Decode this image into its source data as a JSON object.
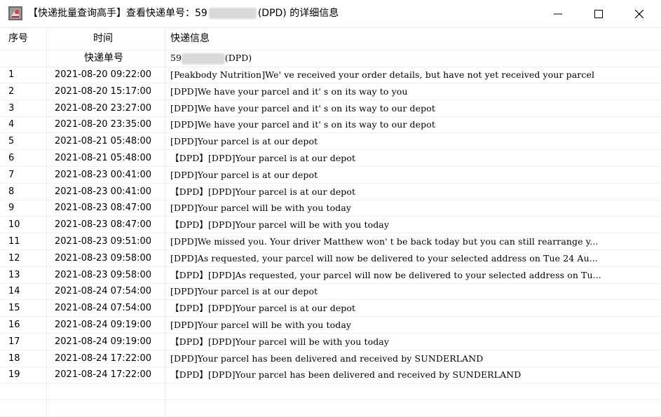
{
  "window": {
    "title_prefix": "【快递批量查询高手】查看快递单号：59",
    "title_suffix": "(DPD) 的详细信息"
  },
  "columns": {
    "no": "序号",
    "time": "时间",
    "info": "快递信息",
    "tracking_label": "快递单号",
    "tracking_prefix": "59",
    "tracking_suffix": "(DPD)"
  },
  "rows": [
    {
      "no": "1",
      "time": "2021-08-20 09:22:00",
      "info": "[Peakbody Nutrition]We' ve received your order details, but have not yet received your parcel"
    },
    {
      "no": "2",
      "time": "2021-08-20 15:17:00",
      "info": "[DPD]We have your parcel and it' s on its way to you"
    },
    {
      "no": "3",
      "time": "2021-08-20 23:27:00",
      "info": "[DPD]We have your parcel and it' s on its way to our depot"
    },
    {
      "no": "4",
      "time": "2021-08-20 23:35:00",
      "info": "[DPD]We have your parcel and it' s on its way to our depot"
    },
    {
      "no": "5",
      "time": "2021-08-21 05:48:00",
      "info": "[DPD]Your parcel is at our depot"
    },
    {
      "no": "6",
      "time": "2021-08-21 05:48:00",
      "info": "【DPD】[DPD]Your parcel is at our depot"
    },
    {
      "no": "7",
      "time": "2021-08-23 00:41:00",
      "info": "[DPD]Your parcel is at our depot"
    },
    {
      "no": "8",
      "time": "2021-08-23 00:41:00",
      "info": "【DPD】[DPD]Your parcel is at our depot"
    },
    {
      "no": "9",
      "time": "2021-08-23 08:47:00",
      "info": "[DPD]Your parcel will be with you today"
    },
    {
      "no": "10",
      "time": "2021-08-23 08:47:00",
      "info": "【DPD】[DPD]Your parcel will be with you today"
    },
    {
      "no": "11",
      "time": "2021-08-23 09:51:00",
      "info": "[DPD]We missed you. Your driver Matthew won' t be back today but you can still rearrange y..."
    },
    {
      "no": "12",
      "time": "2021-08-23 09:58:00",
      "info": "[DPD]As requested, your parcel will now be delivered to your selected address on Tue 24 Au..."
    },
    {
      "no": "13",
      "time": "2021-08-23 09:58:00",
      "info": "【DPD】[DPD]As requested, your parcel will now be delivered to your selected address on Tu..."
    },
    {
      "no": "14",
      "time": "2021-08-24 07:54:00",
      "info": "[DPD]Your parcel is at our depot"
    },
    {
      "no": "15",
      "time": "2021-08-24 07:54:00",
      "info": "【DPD】[DPD]Your parcel is at our depot"
    },
    {
      "no": "16",
      "time": "2021-08-24 09:19:00",
      "info": "[DPD]Your parcel will be with you today"
    },
    {
      "no": "17",
      "time": "2021-08-24 09:19:00",
      "info": "【DPD】[DPD]Your parcel will be with you today"
    },
    {
      "no": "18",
      "time": "2021-08-24 17:22:00",
      "info": "[DPD]Your parcel has been delivered and received by SUNDERLAND"
    },
    {
      "no": "19",
      "time": "2021-08-24 17:22:00",
      "info": "【DPD】[DPD]Your parcel has been delivered and received by SUNDERLAND"
    }
  ],
  "icons": {
    "app": "app-logo-icon",
    "minimize": "minimize-icon",
    "maximize": "maximize-icon",
    "close": "close-icon"
  }
}
